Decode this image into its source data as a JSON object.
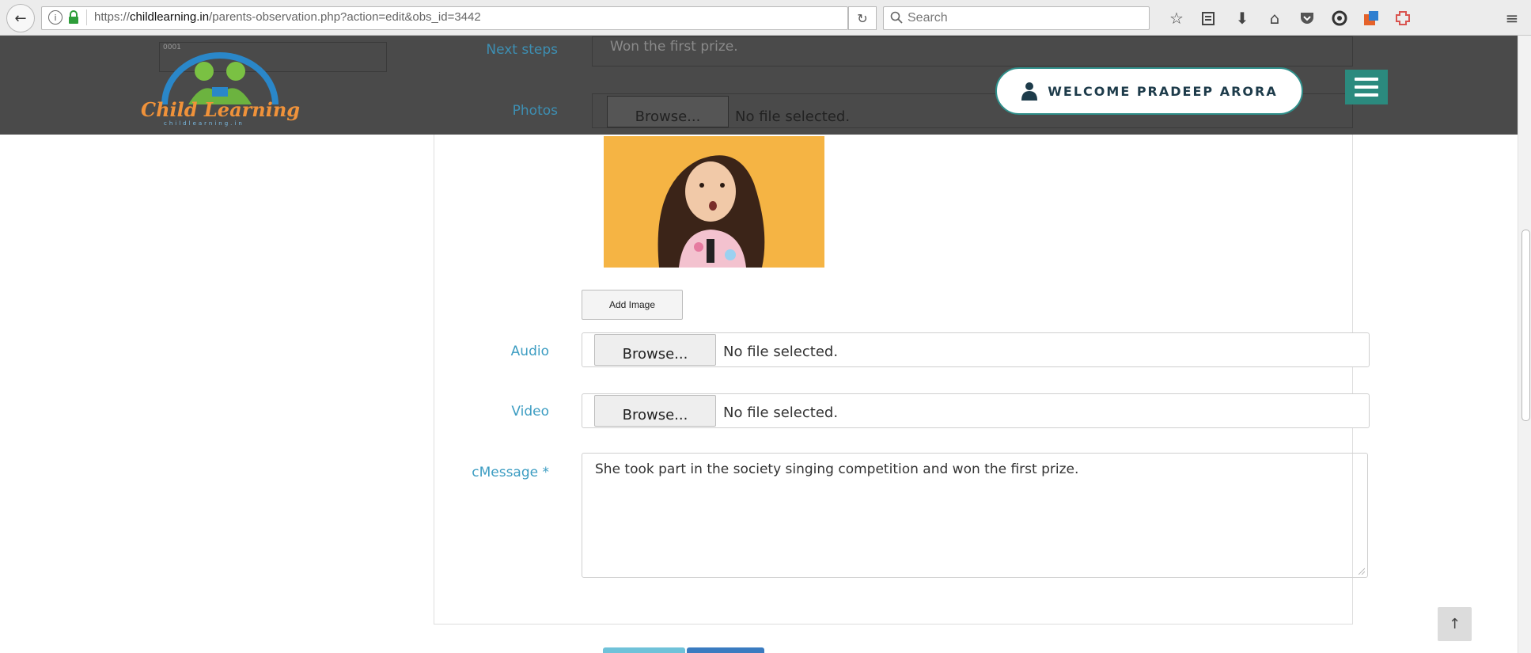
{
  "browser": {
    "url_prefix": "https://",
    "url_host": "childlearning.in",
    "url_path": "/parents-observation.php?action=edit&obs_id=3442",
    "search_placeholder": "Search"
  },
  "header": {
    "logo_text": "Child Learning",
    "logo_sub": "childlearning.in",
    "id_value": "0001",
    "welcome": "WELCOME PRADEEP ARORA"
  },
  "form": {
    "next_steps_label": "Next steps",
    "next_steps_value": "Won the first prize.",
    "photos_label": "Photos",
    "add_image_label": "Add Image",
    "audio_label": "Audio",
    "video_label": "Video",
    "message_label": "cMessage *",
    "message_value": "She took part in the society singing competition and won the first prize.",
    "browse_label": "Browse...",
    "no_file_text": "No file selected."
  },
  "colors": {
    "label": "#3d9dc2",
    "header_bg": "#4a4a4a",
    "menu_bg": "#2b8a7e",
    "photo_bg": "#f5b444",
    "btn_primary_light": "#5bc0de",
    "btn_primary_dark": "#337ab7"
  },
  "icons": {
    "back": "back-arrow-icon",
    "info": "info-icon",
    "lock": "lock-icon",
    "reload": "reload-icon",
    "search": "search-icon",
    "bookmark_star": "star-icon",
    "reader": "reading-list-icon",
    "download": "download-icon",
    "home": "home-icon",
    "pocket": "pocket-icon",
    "extension1": "extension-icon",
    "extension2": "addon-icon",
    "extension3": "puzzle-icon",
    "menu": "hamburger-icon",
    "user": "user-icon",
    "top": "arrow-up-icon"
  }
}
